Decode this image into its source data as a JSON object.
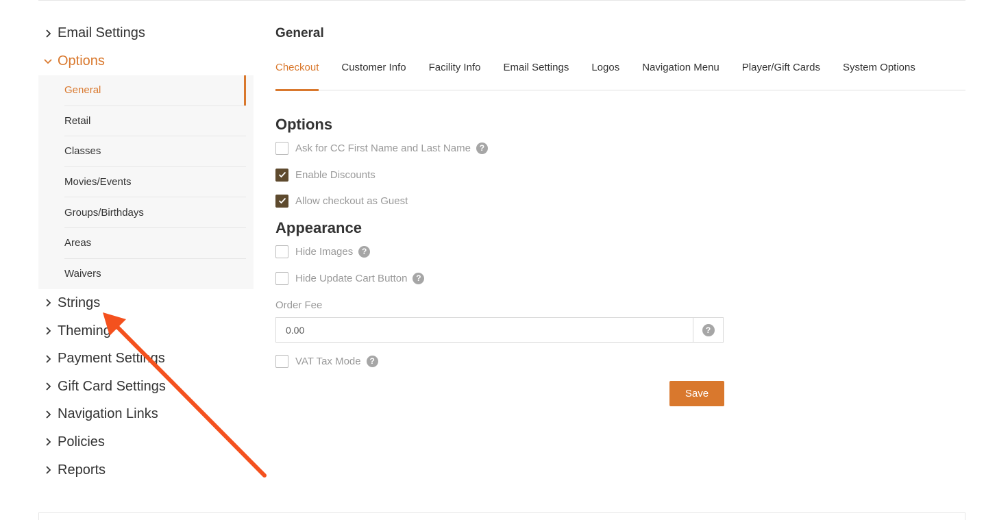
{
  "sidebar": {
    "top": [
      {
        "label": "Email Settings",
        "open": false
      },
      {
        "label": "Options",
        "open": true
      }
    ],
    "options_sub": [
      {
        "label": "General",
        "active": true
      },
      {
        "label": "Retail"
      },
      {
        "label": "Classes"
      },
      {
        "label": "Movies/Events"
      },
      {
        "label": "Groups/Birthdays"
      },
      {
        "label": "Areas"
      },
      {
        "label": "Waivers"
      }
    ],
    "lower": [
      {
        "label": "Strings"
      },
      {
        "label": "Theming"
      },
      {
        "label": "Payment Settings"
      },
      {
        "label": "Gift Card Settings"
      },
      {
        "label": "Navigation Links"
      },
      {
        "label": "Policies"
      },
      {
        "label": "Reports"
      }
    ]
  },
  "main": {
    "title": "General",
    "tabs": [
      {
        "label": "Checkout",
        "active": true
      },
      {
        "label": "Customer Info"
      },
      {
        "label": "Facility Info"
      },
      {
        "label": "Email Settings"
      },
      {
        "label": "Logos"
      },
      {
        "label": "Navigation Menu"
      },
      {
        "label": "Player/Gift Cards"
      },
      {
        "label": "System Options"
      }
    ],
    "options_heading": "Options",
    "options": [
      {
        "label": "Ask for CC First Name and Last Name",
        "checked": false,
        "help": true
      },
      {
        "label": "Enable Discounts",
        "checked": true,
        "help": false
      },
      {
        "label": "Allow checkout as Guest",
        "checked": true,
        "help": false
      }
    ],
    "appearance_heading": "Appearance",
    "appearance": [
      {
        "label": "Hide Images",
        "checked": false,
        "help": true
      },
      {
        "label": "Hide Update Cart Button",
        "checked": false,
        "help": true
      }
    ],
    "order_fee_label": "Order Fee",
    "order_fee_value": "0.00",
    "vat": {
      "label": "VAT Tax Mode",
      "checked": false,
      "help": true
    },
    "help_glyph": "?",
    "save_label": "Save"
  },
  "colors": {
    "accent": "#d9782d",
    "checkbox_checked": "#5e4a2e",
    "annotation_arrow": "#f4511e"
  },
  "icons": {
    "collapsed": "chevron-right-icon",
    "expanded": "chevron-down-icon",
    "help": "question-circle-icon",
    "check": "check-icon"
  }
}
